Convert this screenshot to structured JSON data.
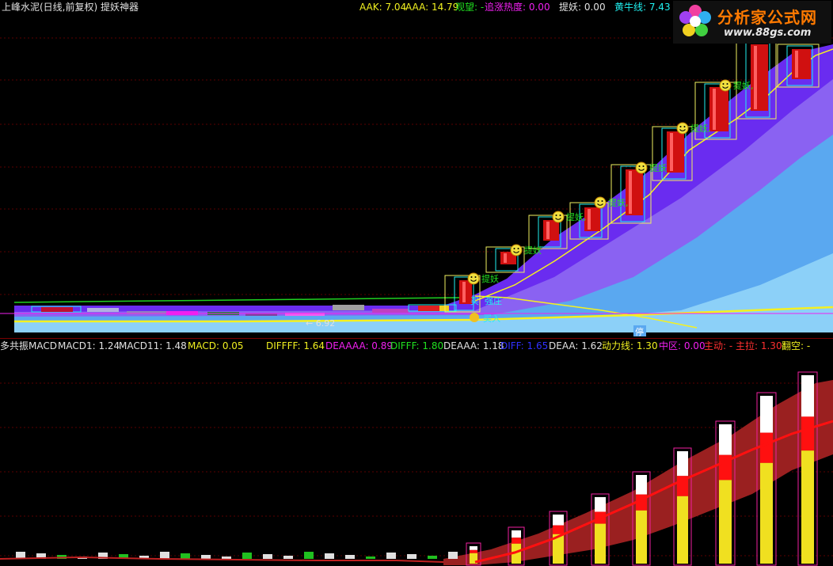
{
  "header": {
    "title": "上峰水泥(日线,前复权) 提妖神器",
    "aak": "AAK: 7.04",
    "aaa": "AAA: 14.79",
    "guanwang": "观望: -",
    "zhuizhang": "追涨热度: 0.00",
    "tiyao": "提妖: 0.00",
    "huangniu": "黄牛线: 7.43"
  },
  "logo": {
    "brand_cn": "分析家公式网",
    "url": "www.88gs.com"
  },
  "top_chart": {
    "price_low_label": "← 6.92",
    "stop_label": "停",
    "signal_labels": [
      "提妖",
      "提妖",
      "提妖,",
      "提妖,",
      "提妖",
      "提妖,",
      "提妖,"
    ],
    "box_labels": [
      "买",
      "强庄",
      "买入"
    ]
  },
  "indicator": {
    "title": "多共振MACD",
    "macd1": "MACD1: 1.24",
    "macd11": "MACD11: 1.48",
    "macd": "MACD: 0.05",
    "diffff": "DIFFFF: 1.64",
    "deaaaa": "DEAAAA: 0.89",
    "difff": "DIFFF: 1.80",
    "deaaa": "DEAAA: 1.18",
    "diff": "DIFF: 1.65",
    "deaa": "DEAA: 1.62",
    "dongli": "动力线: 1.30",
    "zhongqu": "中区: 0.00",
    "zhudong": "主动: -",
    "zhula": "主拉: 1.30",
    "fankong": "翻空: -"
  },
  "colors": {
    "background": "#000000",
    "candle_red": "#d01010",
    "band_purple": "#6a2cf0",
    "band_blue": "#5aa8f0",
    "line_yellow": "#f5f020",
    "line_green": "#20d020",
    "text_green": "#20e020",
    "text_magenta": "#f020f0",
    "text_yellow": "#f0f020",
    "text_cyan": "#20f0f0",
    "text_red": "#ff3030"
  }
}
